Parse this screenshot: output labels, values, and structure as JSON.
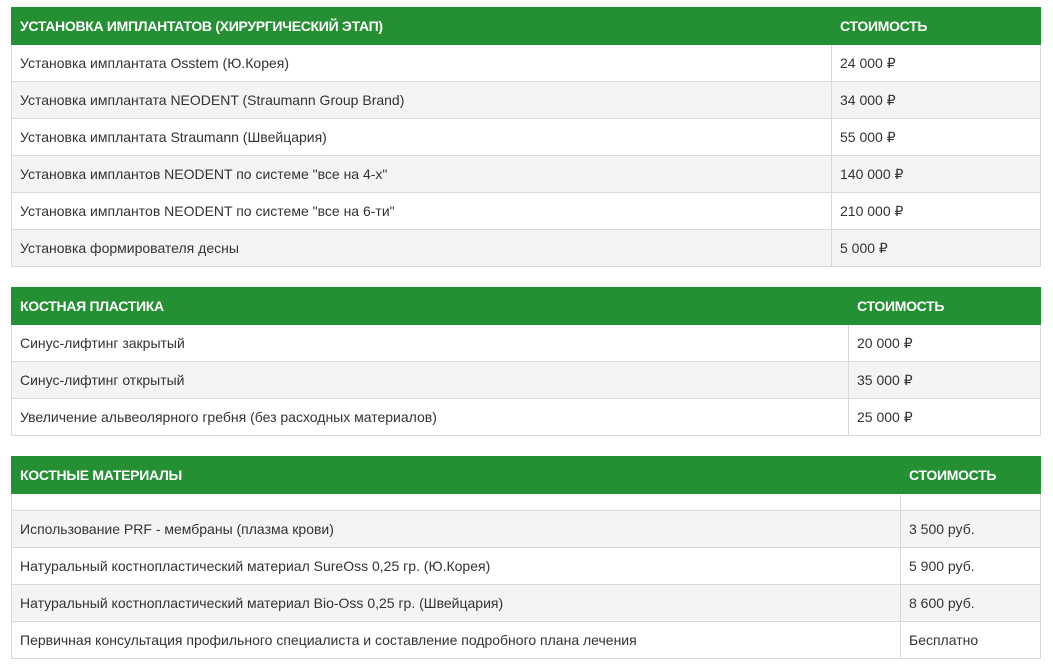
{
  "tables": [
    {
      "header_title": "УСТАНОВКА ИМПЛАНТАТОВ (ХИРУРГИЧЕСКИЙ ЭТАП)",
      "header_price": "СТОИМОСТЬ",
      "rows": [
        {
          "name": "Установка имплантата Osstem (Ю.Корея)",
          "price": "24 000 ₽"
        },
        {
          "name": "Установка имплантата NEODENT (Straumann Group Brand)",
          "price": "34 000 ₽"
        },
        {
          "name": "Установка имплантата Straumann (Швейцария)",
          "price": "55 000 ₽"
        },
        {
          "name": "Установка имплантов NEODENT по системе \"все на 4-х\"",
          "price": "140 000 ₽"
        },
        {
          "name": "Установка имплантов NEODENT по системе \"все на 6-ти\"",
          "price": "210 000 ₽"
        },
        {
          "name": "Установка формирователя десны",
          "price": "5 000 ₽"
        }
      ]
    },
    {
      "header_title": "КОСТНАЯ ПЛАСТИКА",
      "header_price": "СТОИМОСТЬ",
      "rows": [
        {
          "name": "Синус-лифтинг закрытый",
          "price": "20 000 ₽"
        },
        {
          "name": "Синус-лифтинг открытый",
          "price": "35 000 ₽"
        },
        {
          "name": "Увеличение альвеолярного гребня (без расходных материалов)",
          "price": "25 000 ₽"
        }
      ]
    },
    {
      "header_title": "КОСТНЫЕ МАТЕРИАЛЫ",
      "header_price": "СТОИМОСТЬ",
      "rows": [
        {
          "name": "",
          "price": ""
        },
        {
          "name": "Использование PRF - мембраны (плазма крови)",
          "price": "3 500 руб."
        },
        {
          "name": "Натуральный костнопластический материал SureOss 0,25 гр. (Ю.Корея)",
          "price": "5 900 руб."
        },
        {
          "name": "Натуральный костнопластический материал Bio-Oss 0,25 гр. (Швейцария)",
          "price": "8 600 руб."
        },
        {
          "name": "Первичная консультация профильного специалиста и составление подробного плана лечения",
          "price": "Бесплатно"
        }
      ]
    }
  ]
}
